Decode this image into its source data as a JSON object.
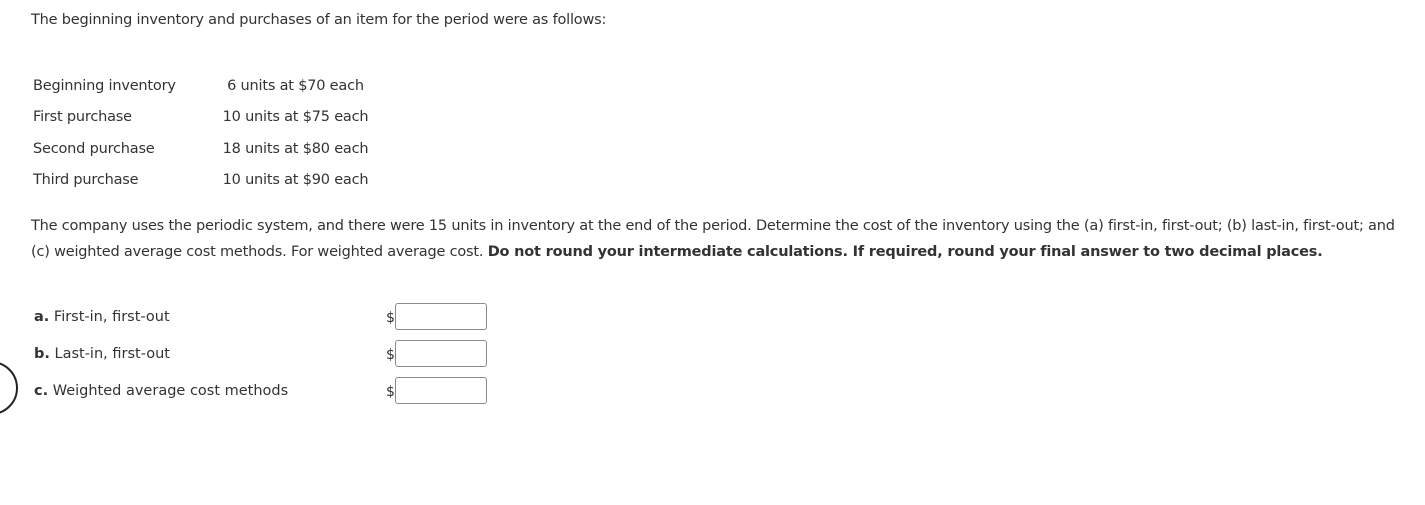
{
  "intro": "The beginning inventory and purchases of an item for the period were as follows:",
  "inventory": [
    {
      "label": "Beginning inventory",
      "value": "6 units at $70 each"
    },
    {
      "label": "First purchase",
      "value": "10 units at $75 each"
    },
    {
      "label": "Second purchase",
      "value": "18 units at $80 each"
    },
    {
      "label": "Third purchase",
      "value": "10 units at $90 each"
    }
  ],
  "instructions": {
    "text": "The company uses the periodic system, and there were 15 units in inventory at the end of the period. Determine the cost of the inventory using the (a) first-in, first-out; (b) last-in, first-out; and (c) weighted average cost methods. For weighted average cost. ",
    "bold": "Do not round your intermediate calculations. If required, round your final answer to two decimal places."
  },
  "answers": [
    {
      "letter": "a.",
      "label": "First-in, first-out",
      "currency": "$",
      "value": ""
    },
    {
      "letter": "b.",
      "label": "Last-in, first-out",
      "currency": "$",
      "value": ""
    },
    {
      "letter": "c.",
      "label": "Weighted average cost methods",
      "currency": "$",
      "value": ""
    }
  ]
}
